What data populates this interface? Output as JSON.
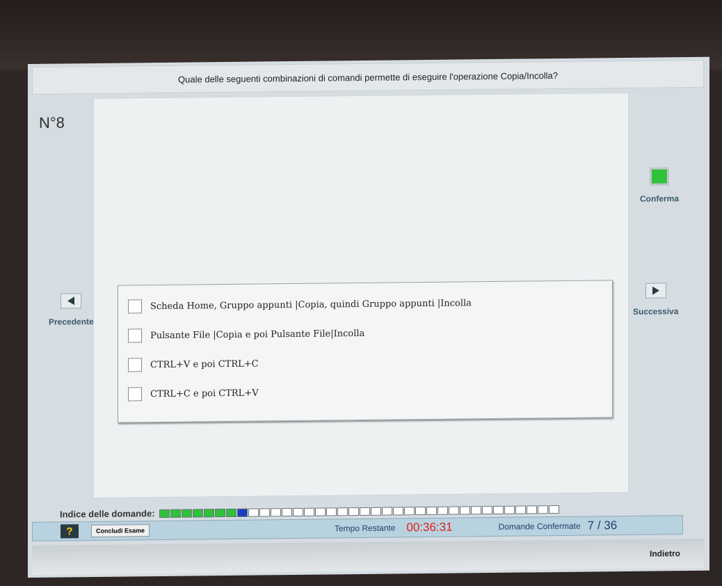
{
  "question": {
    "text": "Quale delle seguenti combinazioni di comandi permette di eseguire l'operazione Copia/Incolla?",
    "number": "N°8"
  },
  "answers": [
    {
      "label": "Scheda Home, Gruppo appunti  |Copia, quindi Gruppo appunti |Incolla",
      "checked": false
    },
    {
      "label": "Pulsante File |Copia e poi Pulsante File|Incolla",
      "checked": false
    },
    {
      "label": "CTRL+V e poi CTRL+C",
      "checked": false
    },
    {
      "label": "CTRL+C e poi CTRL+V",
      "checked": false
    }
  ],
  "nav": {
    "prev_label": "Precedente",
    "next_label": "Successiva",
    "confirm_label": "Conferma"
  },
  "index": {
    "label": "Indice delle domande:",
    "total": 36,
    "confirmed": 7,
    "current": 8
  },
  "bottom": {
    "help_label": "?",
    "end_exam_label": "Concludi Esame",
    "time_label": "Tempo Restante",
    "time_value": "00:36:31",
    "confirmed_label": "Domande Confermate",
    "confirmed_value": "7 / 36",
    "back_label": "Indietro"
  },
  "colors": {
    "confirmed_cell": "#2fc23a",
    "current_cell": "#1a3fc0",
    "time_red": "#e0201a"
  }
}
